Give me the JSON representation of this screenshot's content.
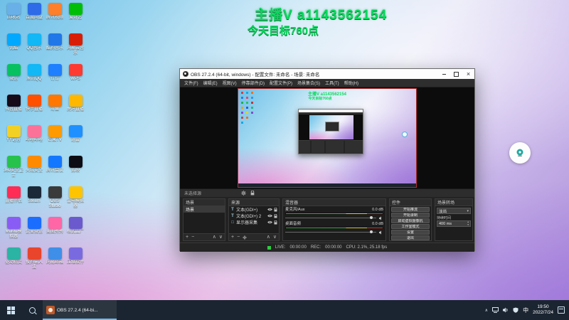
{
  "overlay": {
    "line1": "主播V a1143562154",
    "line2": "今天目标760点",
    "color": "#0bd85e"
  },
  "desktop": {
    "icons": [
      {
        "label": "回收站",
        "color": "#6ab0e8"
      },
      {
        "label": "百度网盘",
        "color": "#2d6be8"
      },
      {
        "label": "腾讯视频",
        "color": "#ff7f2a"
      },
      {
        "label": "爱奇艺",
        "color": "#00be06"
      },
      {
        "label": "优酷",
        "color": "#00a8ff"
      },
      {
        "label": "QQ音乐",
        "color": "#12b7f5"
      },
      {
        "label": "酷狗音乐",
        "color": "#2077e8"
      },
      {
        "label": "网易云音乐",
        "color": "#d81e06"
      },
      {
        "label": "微信",
        "color": "#07c160"
      },
      {
        "label": "腾讯QQ",
        "color": "#12b7f5"
      },
      {
        "label": "钉钉",
        "color": "#1e7fff"
      },
      {
        "label": "WPS",
        "color": "#ff3a30"
      },
      {
        "label": "抖音直播",
        "color": "#170b1a"
      },
      {
        "label": "快手直播",
        "color": "#ff5000"
      },
      {
        "label": "斗鱼",
        "color": "#ff7700"
      },
      {
        "label": "虎牙直播",
        "color": "#ffb700"
      },
      {
        "label": "YY语音",
        "color": "#f3d024"
      },
      {
        "label": "哔哩哔哩",
        "color": "#fb7299"
      },
      {
        "label": "芒果TV",
        "color": "#ff9a00"
      },
      {
        "label": "迅雷",
        "color": "#1e90ff"
      },
      {
        "label": "360安全卫士",
        "color": "#27c24c"
      },
      {
        "label": "火绒安全",
        "color": "#ff8a00"
      },
      {
        "label": "腾讯会议",
        "color": "#1477ff"
      },
      {
        "label": "剪映",
        "color": "#0c0c14"
      },
      {
        "label": "直播伴侣",
        "color": "#ff2d55"
      },
      {
        "label": "Steam",
        "color": "#1b2838"
      },
      {
        "label": "OBS Studio",
        "color": "#3a3a3a"
      },
      {
        "label": "雷电模拟器",
        "color": "#ffc400"
      },
      {
        "label": "MuMu模拟器",
        "color": "#8a5cf6"
      },
      {
        "label": "企业微信",
        "color": "#1a6dff"
      },
      {
        "label": "美图秀秀",
        "color": "#ff66a6"
      },
      {
        "label": "格式工厂",
        "color": "#6a5acd"
      },
      {
        "label": "驱动精灵",
        "color": "#2bb3a3"
      },
      {
        "label": "搜狗输入法",
        "color": "#e8452c"
      },
      {
        "label": "网易邮箱",
        "color": "#3f8fe8"
      },
      {
        "label": "压缩软件",
        "color": "#7a6ae0"
      }
    ]
  },
  "obs": {
    "title": "OBS 27.2.4 (64-bit, windows) - 配置文件: 未命名 - 场景: 未命名",
    "menus": [
      "文件(F)",
      "编辑(E)",
      "视图(V)",
      "停靠部件(D)",
      "配置文件(P)",
      "场景集合(S)",
      "工具(T)",
      "帮助(H)"
    ],
    "source_toolbar": {
      "no_source_label": "未选择源"
    },
    "scenes": {
      "title": "场景",
      "items": [
        "场景"
      ]
    },
    "sources": {
      "title": "来源",
      "items": [
        {
          "icon": "T",
          "label": "文本(GDI+)"
        },
        {
          "icon": "T",
          "label": "文本(GDI+) 2"
        },
        {
          "icon": "□",
          "label": "显示器采集"
        }
      ]
    },
    "mixer": {
      "title": "混音器",
      "channels": [
        {
          "name": "麦克风/Aux",
          "db": "0.0 dB"
        },
        {
          "name": "桌面音频",
          "db": "0.0 dB"
        }
      ]
    },
    "controls": {
      "title": "控件",
      "buttons": [
        "开始推流",
        "开始录制",
        "启动虚拟摄像机",
        "工作室模式",
        "设置",
        "退出"
      ]
    },
    "transitions": {
      "title": "场景转场",
      "selected": "淡出",
      "duration_label": "持续时间",
      "duration_value": "400 ms"
    },
    "status": {
      "live_label": "LIVE:",
      "live_time": "00:00:00",
      "rec_label": "REC:",
      "rec_time": "00:00:00",
      "stats": "CPU: 2.1%, 25.18 fps"
    }
  },
  "taskbar": {
    "obs_button": "OBS 27.2.4 (64-bi...",
    "ime": "中",
    "time": "19:50",
    "date": "2022/7/24"
  },
  "icons": {
    "close": "×",
    "plus": "+",
    "minus": "−",
    "up": "∧",
    "down": "∨",
    "combo_arrow": "▾",
    "spin_up": "▴",
    "spin_down": "▾",
    "tray_chevron": "∧"
  },
  "colors": {
    "overlay_green": "#0bd85e",
    "taskbar_accent": "#76b9ed",
    "live_indicator": "#2ecc40"
  }
}
